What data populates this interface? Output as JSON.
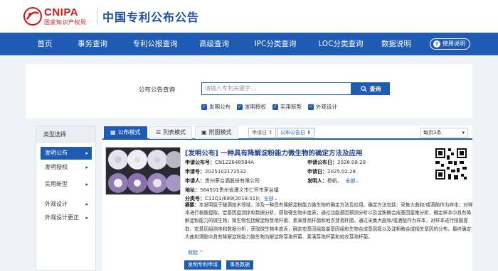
{
  "header": {
    "logo_text": "CNIPA",
    "logo_sub": "国家知识产权局",
    "site_title": "中国专利公布公告"
  },
  "nav": {
    "items": [
      "首页",
      "事务查询",
      "专利公报查询",
      "高级查询",
      "IPC分类查询",
      "LOC分类查询",
      "数据说明"
    ],
    "help_label": "使用说明"
  },
  "search": {
    "label": "公布公告查询",
    "placeholder": "请输入专利关键字...",
    "button_label": "查询",
    "filters": [
      "发明公布",
      "发明授权",
      "实用新型",
      "外观设计"
    ]
  },
  "sidebar": {
    "title": "类型选择",
    "items": [
      {
        "label": "发明公布",
        "active": true
      },
      {
        "label": "发明授权",
        "active": false
      },
      {
        "label": "实用新型",
        "active": false
      },
      {
        "label": "外观设计",
        "active": false
      },
      {
        "label": "外观设计更正",
        "active": false
      }
    ]
  },
  "toolbar": {
    "tabs": [
      "公布模式",
      "列表模式",
      "附图模式"
    ],
    "sort_date": "申请日 ↕",
    "sort_pub": "公布公告日 ⬇",
    "per_page": "每页3条"
  },
  "result": {
    "title": "[发明公布] 一种具有降解淀粉能力微生物的确定方法及应用",
    "app_no_label": "申请公布号：",
    "app_no": "CN122648584A",
    "pub_date_label": "申请公布日：",
    "pub_date": "2026.08.28",
    "app_number_label": "申请号：",
    "app_number": "2025102172532",
    "app_date_label": "申请日：",
    "app_date": "2025.02.26",
    "applicant_label": "申请人：",
    "applicant": "贵州茅台酒股份有限公司",
    "inventor_label": "发明人：",
    "inventor": "杨帆、",
    "inventor_more": "全部",
    "address_label": "地址：",
    "address": "564501贵州省遵义市仁怀市茅台镇",
    "classification_label": "分类号：",
    "classification": "C12Q1/689(2018.01)I;",
    "classification_more": "全部",
    "abstract_label": "摘要：",
    "abstract": "本发明属于酿酒技术领域，涉及一种具有降解淀粉能力微生物的确定方法及应用。确定方法包括：采集大曲和/或酒醅作为样本；对样本进行核酸提取，宏基因组测序和数据分析，获取微生物丰度表；通过功能基因预测分析以及淀粉酶合成基因富集分析，确定样本中具有降解淀粉能力的微生物；微生物包括解淀粉芽孢杆菌、素满芽孢杆菌和地衣芽孢杆菌。通过采集大曲和/或酒醅作为样本，对样本进行核酸提取、宏基因组测序和数据分析，获取微生物丰度表，确定宏基因组能量基因组和生物合成基因簇以及淀粉酶合成相关基因的分布，最终确定大曲和酒醅中具有降解淀粉能力微生物为解淀粉芽孢杆菌、素满芽孢杆菌和地衣芽孢杆菌。",
    "collapse_label": "收起",
    "actions": [
      "发明专利申请",
      "事务数据"
    ]
  }
}
